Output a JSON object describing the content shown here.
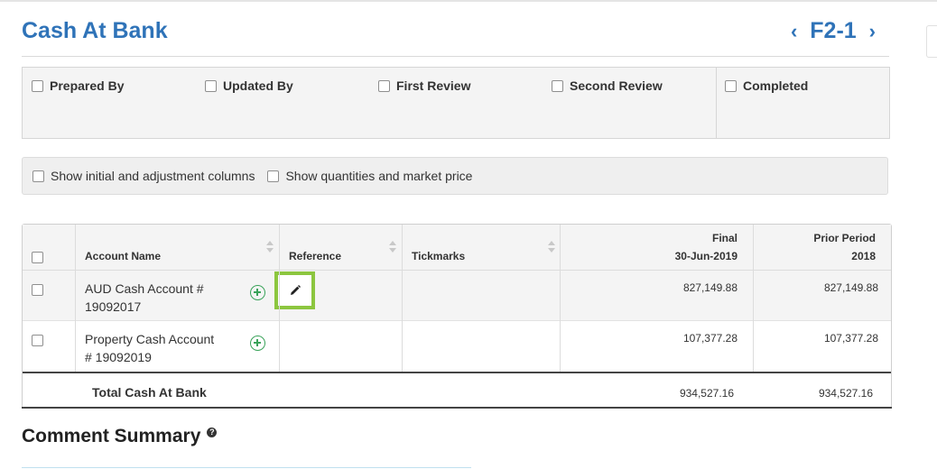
{
  "page": {
    "title": "Cash At Bank",
    "code": "F2-1",
    "prev_icon": "chevron-left-icon",
    "next_icon": "chevron-right-icon"
  },
  "signoff": {
    "items": [
      {
        "label": "Prepared By",
        "checked": false
      },
      {
        "label": "Updated By",
        "checked": false
      },
      {
        "label": "First Review",
        "checked": false
      },
      {
        "label": "Second Review",
        "checked": false
      },
      {
        "label": "Completed",
        "checked": false
      }
    ]
  },
  "options": [
    {
      "label": "Show initial and adjustment columns",
      "checked": false
    },
    {
      "label": "Show quantities and market price",
      "checked": false
    }
  ],
  "table": {
    "headers": {
      "account_name": "Account Name",
      "reference": "Reference",
      "tickmarks": "Tickmarks",
      "final": "Final",
      "final_date": "30-Jun-2019",
      "prior": "Prior Period",
      "prior_year": "2018"
    },
    "rows": [
      {
        "account": "AUD Cash Account # 19092017",
        "final": "827,149.88",
        "prior": "827,149.88"
      },
      {
        "account": "Property Cash Account # 19092019",
        "final": "107,377.28",
        "prior": "107,377.28"
      }
    ],
    "total": {
      "label": "Total Cash At Bank",
      "final": "934,527.16",
      "prior": "934,527.16"
    }
  },
  "comments": {
    "title": "Comment Summary"
  },
  "colors": {
    "accent": "#2f73b8",
    "highlight": "#8cc63f",
    "add": "#3aa35a"
  }
}
